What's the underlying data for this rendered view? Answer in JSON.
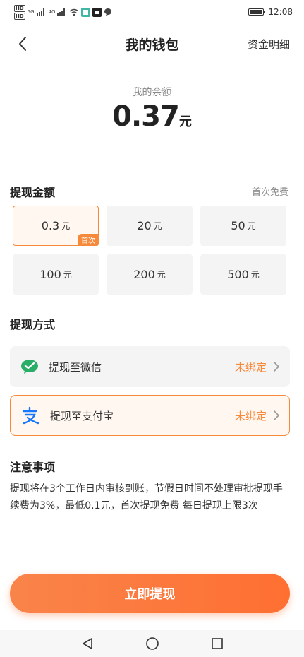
{
  "status_bar": {
    "chip_top": "HD",
    "chip_bottom": "HD",
    "net1": "5G",
    "net2": "4G",
    "time": "12:08"
  },
  "nav": {
    "title": "我的钱包",
    "right_link": "资金明细"
  },
  "balance": {
    "label": "我的余额",
    "amount": "0.37",
    "unit": "元"
  },
  "withdraw_amount": {
    "title": "提现金额",
    "hint": "首次免费",
    "options": [
      {
        "value": "0.3",
        "unit": "元",
        "tag": "首次"
      },
      {
        "value": "20",
        "unit": "元"
      },
      {
        "value": "50",
        "unit": "元"
      },
      {
        "value": "100",
        "unit": "元"
      },
      {
        "value": "200",
        "unit": "元"
      },
      {
        "value": "500",
        "unit": "元"
      }
    ],
    "selected_index": 0
  },
  "withdraw_method": {
    "title": "提现方式",
    "methods": [
      {
        "label": "提现至微信",
        "status": "未绑定",
        "icon": "wechat-icon"
      },
      {
        "label": "提现至支付宝",
        "status": "未绑定",
        "icon": "alipay-icon"
      }
    ],
    "selected_index": 1
  },
  "notes": {
    "title": "注意事项",
    "text": "提现将在3个工作日内审核到账，节假日时间不处理审批提现手续费为3%，最低0.1元，首次提现免费 每日提现上限3次"
  },
  "submit": {
    "label": "立即提现"
  },
  "colors": {
    "accent": "#f7893a",
    "button": "#ff6f32",
    "wechat": "#2aae67",
    "alipay": "#1677ff"
  }
}
